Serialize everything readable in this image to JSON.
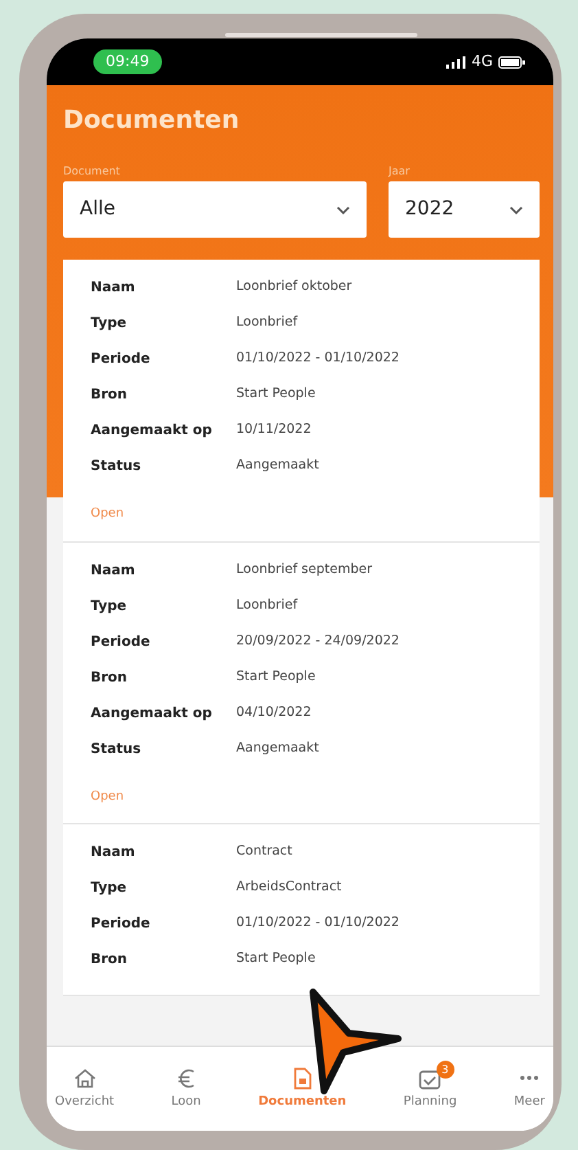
{
  "status_bar": {
    "time": "09:49",
    "network": "4G"
  },
  "header": {
    "title": "Documenten"
  },
  "filters": [
    {
      "label": "Document",
      "value": "Alle"
    },
    {
      "label": "Jaar",
      "value": "2022"
    }
  ],
  "documents": [
    {
      "fields": [
        {
          "label": "Naam",
          "value": "Loonbrief oktober"
        },
        {
          "label": "Type",
          "value": "Loonbrief"
        },
        {
          "label": "Periode",
          "value": "01/10/2022 - 01/10/2022"
        },
        {
          "label": "Bron",
          "value": "Start People"
        },
        {
          "label": "Aangemaakt op",
          "value": "10/11/2022"
        },
        {
          "label": "Status",
          "value": "Aangemaakt"
        }
      ],
      "action": "Open"
    },
    {
      "fields": [
        {
          "label": "Naam",
          "value": "Loonbrief september"
        },
        {
          "label": "Type",
          "value": "Loonbrief"
        },
        {
          "label": "Periode",
          "value": "20/09/2022 - 24/09/2022"
        },
        {
          "label": "Bron",
          "value": "Start People"
        },
        {
          "label": "Aangemaakt op",
          "value": "04/10/2022"
        },
        {
          "label": "Status",
          "value": "Aangemaakt"
        }
      ],
      "action": "Open"
    },
    {
      "fields": [
        {
          "label": "Naam",
          "value": "Contract"
        },
        {
          "label": "Type",
          "value": "ArbeidsContract"
        },
        {
          "label": "Periode",
          "value": "01/10/2022 - 01/10/2022"
        },
        {
          "label": "Bron",
          "value": "Start People"
        }
      ]
    }
  ],
  "tab_bar": [
    {
      "kind": "home",
      "label": "Overzicht",
      "selected": false
    },
    {
      "kind": "euro",
      "label": "Loon",
      "selected": false
    },
    {
      "kind": "document",
      "label": "Documenten",
      "selected": true
    },
    {
      "kind": "calendar",
      "label": "Planning",
      "selected": false,
      "badge": "3"
    },
    {
      "kind": "more",
      "label": "Meer",
      "selected": false
    }
  ]
}
